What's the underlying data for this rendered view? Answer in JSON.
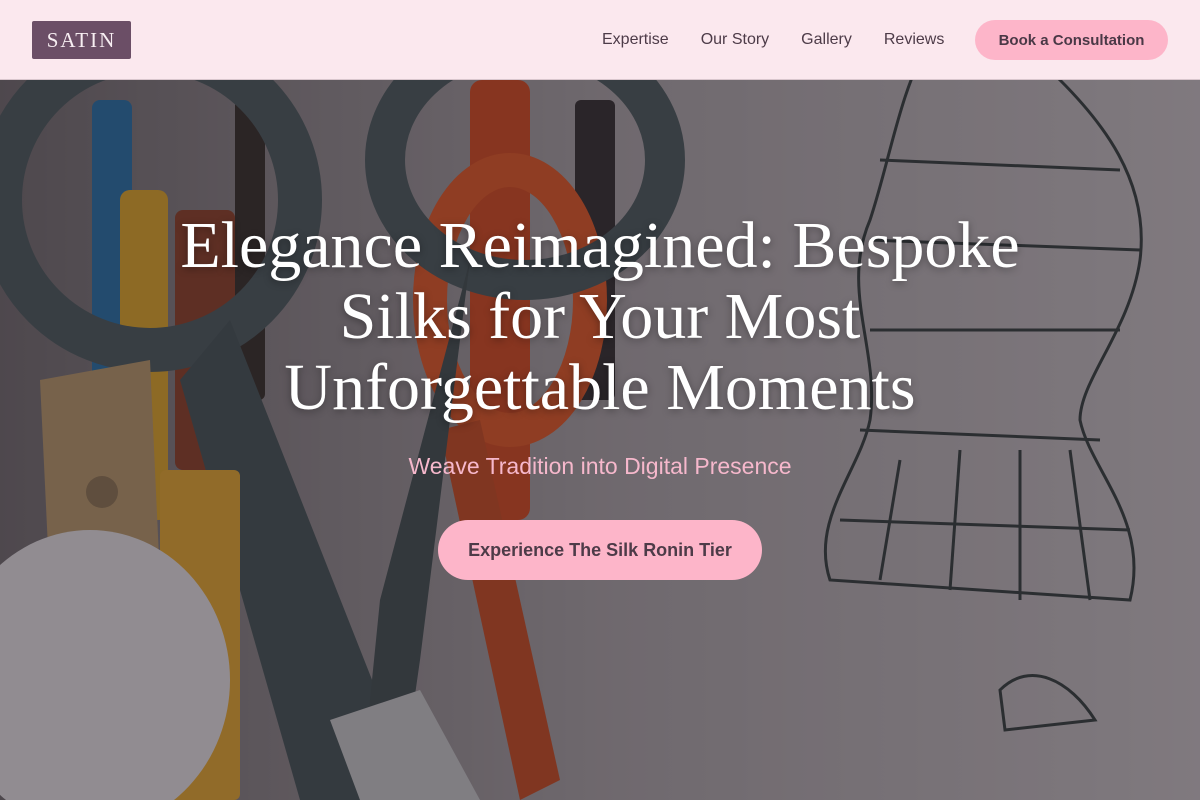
{
  "brand": {
    "logo_text": "SATIN"
  },
  "nav": {
    "links": [
      {
        "label": "Expertise"
      },
      {
        "label": "Our Story"
      },
      {
        "label": "Gallery"
      },
      {
        "label": "Reviews"
      }
    ],
    "cta_label": "Book a Consultation"
  },
  "hero": {
    "title": "Elegance Reimagined: Bespoke Silks for Your Most Unforgettable Moments",
    "subtitle": "Weave Tradition into Digital Presence",
    "cta_label": "Experience The Silk Ronin Tier",
    "background_image": "photo-of-scissors-pencils-and-sketch"
  },
  "colors": {
    "nav_background": "#fbe8ee",
    "logo_background": "#6b4e66",
    "accent_pink": "#fdb5c9",
    "subtitle_pink": "#f6b8cc",
    "text_dark": "#4d3b48",
    "hero_title": "#ffffff"
  }
}
